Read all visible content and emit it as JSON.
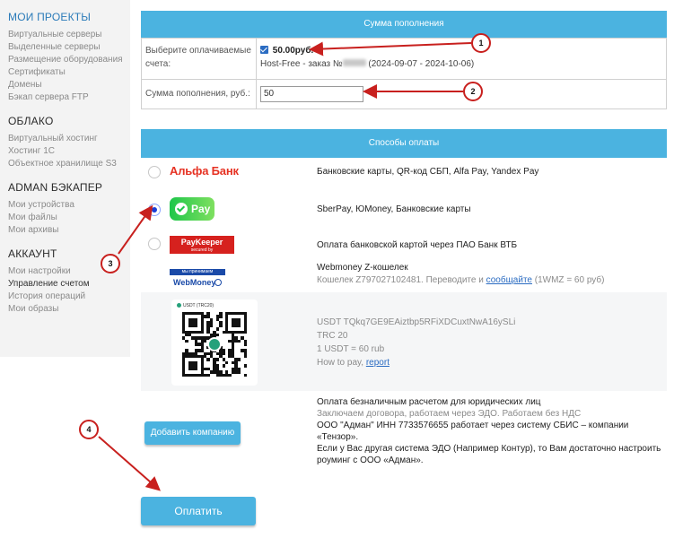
{
  "sidebar": {
    "sections": [
      {
        "title": "МОИ ПРОЕКТЫ",
        "items": [
          "Виртуальные серверы",
          "Выделенные серверы",
          "Размещение оборудования",
          "Сертификаты",
          "Домены",
          "Бэкап сервера FTP"
        ]
      },
      {
        "title": "ОБЛАКО",
        "items": [
          "Виртуальный хостинг",
          "Хостинг 1С",
          "Объектное хранилище S3"
        ]
      },
      {
        "title": "ADMAN БЭКАПЕР",
        "items": [
          "Мои устройства",
          "Мои файлы",
          "Мои архивы"
        ]
      },
      {
        "title": "АККАУНТ",
        "items": [
          "Мои настройки",
          "Управление счетом",
          "История операций",
          "Мои образы"
        ]
      }
    ]
  },
  "topup": {
    "header": "Сумма пополнения",
    "select_label": "Выберите оплачиваемые счета:",
    "invoice_amount": "50.00руб.",
    "invoice_prefix": "Host-Free - заказ №",
    "invoice_period": "(2024-09-07 - 2024-10-06)",
    "amount_label": "Сумма пополнения, руб.:",
    "amount_value": "50"
  },
  "methods": {
    "header": "Способы оплаты",
    "alfa_logo": "Альфа Банк",
    "alfa_text": "Банковские карты, QR-код СБП, Alfa Pay, Yandex Pay",
    "sber_logo": "Pay",
    "sber_text": "SberPay, ЮMoney, Банковские карты",
    "pk_logo": "PayKeeper",
    "pk_logo_sub": "secured by",
    "pk_text": "Оплата банковской картой через ПАО Банк ВТБ",
    "wm_logo_top": "мы принимаем",
    "wm_logo_bottom": "WebMoney",
    "wm_title": "Webmoney Z-кошелек",
    "wm_line_before": "Кошелек Z797027102481. Переводите и",
    "wm_link": "сообщайте",
    "wm_line_after": "(1WMZ = 60 руб)",
    "usdt_qr_label": "USDT (TRC20)",
    "usdt_address": "USDT TQkq7GE9EAiztbp5RFiXDCuxtNwA16ySLi",
    "usdt_network": "TRC 20",
    "usdt_rate": "1 USDT = 60 rub",
    "usdt_howto": "How to pay,",
    "usdt_link": "report",
    "legal_title": "Оплата безналичным расчетом для юридических лиц",
    "legal_muted": "Заключаем договора, работаем через ЭДО. Работаем без НДС",
    "legal_line1": "ООО \"Адман\" ИНН 7733576655 работает через систему СБИС – компании «Тензор».",
    "legal_line2": "Если у Вас другая система ЭДО (Например Контур), то Вам достаточно настроить роуминг с ООО «Адман».",
    "add_company": "Добавить компанию",
    "pay_button": "Оплатить"
  },
  "annotations": [
    "1",
    "2",
    "3",
    "4"
  ],
  "colors": {
    "accent": "#4bb3e0",
    "annotation": "#c8201e",
    "link": "#2b6cc2"
  }
}
